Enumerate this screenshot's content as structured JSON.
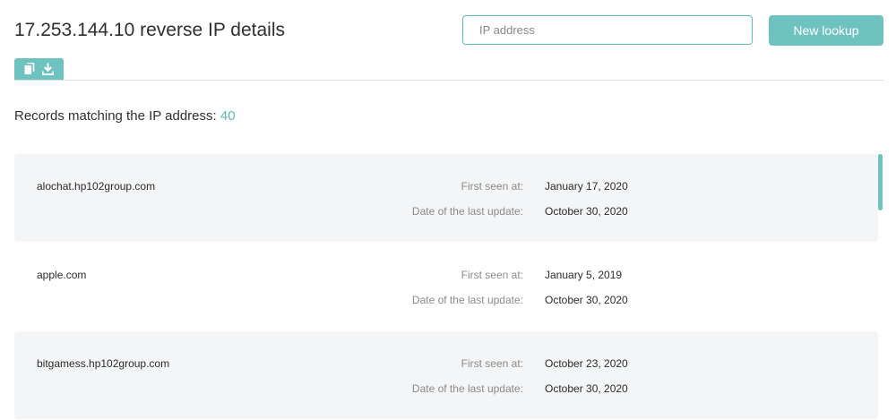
{
  "header": {
    "title": "17.253.144.10 reverse IP details",
    "search_placeholder": "IP address",
    "search_value": "",
    "lookup_button": "New lookup"
  },
  "actions": {
    "icons": [
      "copy-icon",
      "download-icon"
    ]
  },
  "records": {
    "label": "Records matching the IP address:",
    "count": "40",
    "first_seen_label": "First seen at:",
    "last_update_label": "Date of the last update:",
    "items": [
      {
        "domain": "alochat.hp102group.com",
        "first_seen": "January 17, 2020",
        "last_update": "October 30, 2020"
      },
      {
        "domain": "apple.com",
        "first_seen": "January 5, 2019",
        "last_update": "October 30, 2020"
      },
      {
        "domain": "bitgamess.hp102group.com",
        "first_seen": "October 23, 2020",
        "last_update": "October 30, 2020"
      }
    ]
  },
  "colors": {
    "accent": "#6ec3c0",
    "row_shade": "#f4f5f6"
  }
}
